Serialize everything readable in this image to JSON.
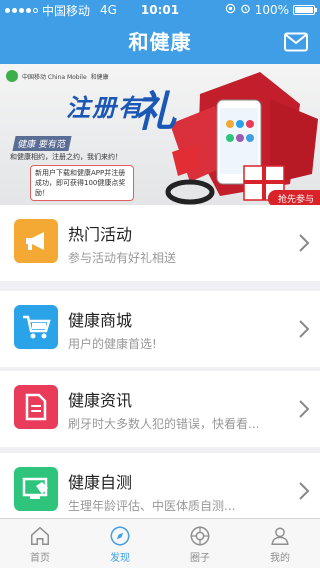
{
  "status_bar": {
    "carrier": "中国移动",
    "network": "4G",
    "time": "10:01",
    "battery": "100%",
    "signal_strength": "4 of 5"
  },
  "nav": {
    "title": "和健康",
    "mail_icon": "mail-icon"
  },
  "banner": {
    "logo_text": "中国移动 China Mobile",
    "brand_text": "和健康",
    "headline": "注册有",
    "headline_big": "礼",
    "tag": "健康  要有范",
    "subline": "和健康相约，注册之约，我们来约！",
    "notice": "新用户下载和健康APP并注册成功，即可获得100健康点奖励！",
    "corner_label": "抢先参与"
  },
  "menu": [
    {
      "title": "热门活动",
      "subtitle": "参与活动有好礼相送",
      "icon": "megaphone-icon",
      "color": "#f3a934"
    },
    {
      "title": "健康商城",
      "subtitle": "用户的健康首选!",
      "icon": "shopping-cart-icon",
      "color": "#2aa3e8"
    },
    {
      "title": "健康资讯",
      "subtitle": "刷牙时大多数人犯的错误，快看看...",
      "icon": "document-icon",
      "color": "#e83c5a"
    },
    {
      "title": "健康自测",
      "subtitle": "生理年龄评估、中医体质自测...",
      "icon": "self-test-icon",
      "color": "#2ec47c"
    }
  ],
  "tabs": [
    {
      "label": "首页",
      "icon": "home-icon",
      "active": false
    },
    {
      "label": "发现",
      "icon": "compass-icon",
      "active": true
    },
    {
      "label": "圈子",
      "icon": "circle-icon",
      "active": false
    },
    {
      "label": "我的",
      "icon": "user-icon",
      "active": false
    }
  ],
  "colors": {
    "primary": "#3f9ee6",
    "background": "#efeff4"
  }
}
